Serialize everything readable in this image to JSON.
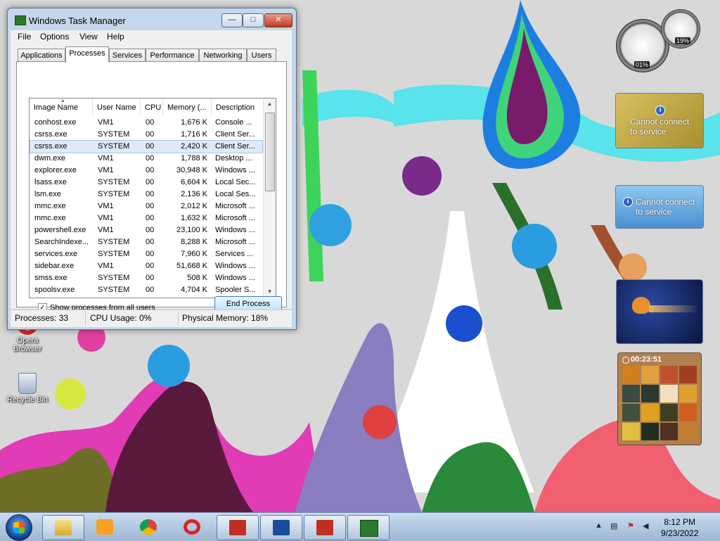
{
  "window": {
    "title": "Windows Task Manager",
    "buttons": {
      "minimize": "—",
      "maximize": "□",
      "close": "✕"
    },
    "menu": [
      "File",
      "Options",
      "View",
      "Help"
    ],
    "tabs": [
      "Applications",
      "Processes",
      "Services",
      "Performance",
      "Networking",
      "Users"
    ],
    "active_tab": "Processes"
  },
  "processes": {
    "columns": [
      "Image Name",
      "User Name",
      "CPU",
      "Memory (...",
      "Description"
    ],
    "rows": [
      [
        "conhost.exe",
        "VM1",
        "00",
        "1,676 K",
        "Console ..."
      ],
      [
        "csrss.exe",
        "SYSTEM",
        "00",
        "1,716 K",
        "Client Ser..."
      ],
      [
        "csrss.exe",
        "SYSTEM",
        "00",
        "2,420 K",
        "Client Ser..."
      ],
      [
        "dwm.exe",
        "VM1",
        "00",
        "1,788 K",
        "Desktop ..."
      ],
      [
        "explorer.exe",
        "VM1",
        "00",
        "30,948 K",
        "Windows ..."
      ],
      [
        "lsass.exe",
        "SYSTEM",
        "00",
        "6,604 K",
        "Local Sec..."
      ],
      [
        "lsm.exe",
        "SYSTEM",
        "00",
        "2,136 K",
        "Local Ses..."
      ],
      [
        "mmc.exe",
        "VM1",
        "00",
        "2,012 K",
        "Microsoft ..."
      ],
      [
        "mmc.exe",
        "VM1",
        "00",
        "1,632 K",
        "Microsoft ..."
      ],
      [
        "powershell.exe",
        "VM1",
        "00",
        "23,100 K",
        "Windows ..."
      ],
      [
        "SearchIndexe...",
        "SYSTEM",
        "00",
        "8,288 K",
        "Microsoft ..."
      ],
      [
        "services.exe",
        "SYSTEM",
        "00",
        "7,960 K",
        "Services ..."
      ],
      [
        "sidebar.exe",
        "VM1",
        "00",
        "51,668 K",
        "Windows ..."
      ],
      [
        "smss.exe",
        "SYSTEM",
        "00",
        "508 K",
        "Windows ..."
      ],
      [
        "spoolsv.exe",
        "SYSTEM",
        "00",
        "4,704 K",
        "Spooler S..."
      ]
    ],
    "selected_row": 2,
    "show_all_users_label": "Show processes from all users",
    "show_all_users_checked": true,
    "end_process_label": "End Process"
  },
  "status": {
    "processes": "Processes: 33",
    "cpu": "CPU Usage: 0%",
    "memory": "Physical Memory: 18%"
  },
  "desktop_icons": [
    {
      "label": "Opera Browser",
      "icon": "opera-icon"
    },
    {
      "label": "Recycle Bin",
      "icon": "recycle-bin-icon"
    }
  ],
  "gadgets": {
    "meter_cpu": "01%",
    "meter_mem": "19%",
    "currency_msg": "Cannot connect to service",
    "weather_msg": "Cannot connect to service",
    "puzzle_timer": "00:23:51"
  },
  "taskbar": {
    "buttons": [
      "start-orb",
      "explorer",
      "media-player",
      "chrome",
      "opera",
      "toolbox",
      "powershell",
      "toolbox-2",
      "task-manager"
    ],
    "time": "8:12 PM",
    "date": "9/23/2022"
  }
}
